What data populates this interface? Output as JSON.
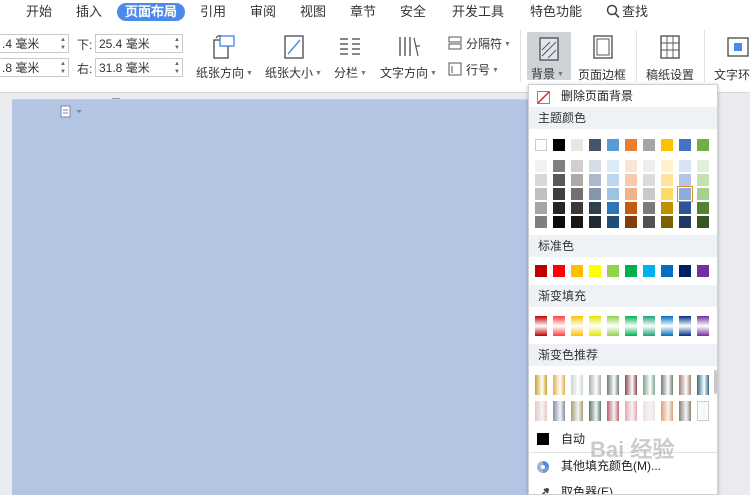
{
  "menu": {
    "tabs": [
      "开始",
      "插入",
      "页面布局",
      "引用",
      "审阅",
      "视图",
      "章节",
      "安全",
      "开发工具",
      "特色功能"
    ],
    "active": "页面布局",
    "search_label": "查找"
  },
  "ribbon": {
    "margin_top_value": ".4 毫米",
    "margin_left_value": ".8 毫米",
    "margin_bottom_label": "下:",
    "margin_bottom_value": "25.4 毫米",
    "margin_right_label": "右:",
    "margin_right_value": "31.8 毫米",
    "orientation": "纸张方向",
    "size": "纸张大小",
    "columns": "分栏",
    "text_direction": "文字方向",
    "separator": "分隔符",
    "line_number": "行号",
    "background": "背景",
    "page_border": "页面边框",
    "grid_paper": "稿纸设置",
    "wrap_text": "文字环"
  },
  "dropdown": {
    "remove_bg": "删除页面背景",
    "theme_colors_title": "主题颜色",
    "standard_colors_title": "标准色",
    "gradient_fill_title": "渐变填充",
    "gradient_recommend_title": "渐变色推荐",
    "auto_label": "自动",
    "more_fill": "其他填充颜色(M)...",
    "eyedropper": "取色器(E)",
    "theme_top": [
      "#ffffff",
      "#000000",
      "#e7e6e6",
      "#44546a",
      "#5b9bd5",
      "#ed7d31",
      "#a5a5a5",
      "#ffc000",
      "#4472c4",
      "#70ad47"
    ],
    "theme_grid": [
      [
        "#f2f2f2",
        "#7f7f7f",
        "#d0cece",
        "#d6dce4",
        "#deebf6",
        "#fbe5d5",
        "#ededed",
        "#fff2cc",
        "#dae3f3",
        "#e2efd9"
      ],
      [
        "#d8d8d8",
        "#595959",
        "#aeaaaa",
        "#adb9ca",
        "#bdd7ee",
        "#f7cbac",
        "#dbdbdb",
        "#fee599",
        "#b4c6e7",
        "#c5e0b3"
      ],
      [
        "#bfbfbf",
        "#3f3f3f",
        "#757070",
        "#8496b0",
        "#9cc3e5",
        "#f4b183",
        "#c9c9c9",
        "#ffd965",
        "#8eaadb",
        "#a8d08d"
      ],
      [
        "#a5a5a5",
        "#262626",
        "#3a3838",
        "#323f4f",
        "#2e75b5",
        "#c55a11",
        "#7b7b7b",
        "#bf9000",
        "#2f5496",
        "#538135"
      ],
      [
        "#7f7f7f",
        "#0c0c0c",
        "#171616",
        "#222a35",
        "#1e4e79",
        "#833c0b",
        "#525252",
        "#7f6000",
        "#1f3864",
        "#375623"
      ]
    ],
    "standard": [
      "#c00000",
      "#ff0000",
      "#ffc000",
      "#ffff00",
      "#92d050",
      "#00b050",
      "#00b0f0",
      "#0070c0",
      "#002060",
      "#7030a0"
    ],
    "gradients": [
      "#c00000",
      "#ff4040",
      "#ffc000",
      "#e6e600",
      "#92d050",
      "#00b050",
      "#1aa37a",
      "#0070c0",
      "#002f86",
      "#7030a0"
    ],
    "recommend_row1": [
      "#c9a227",
      "#e3b04b",
      "#c8d8d4",
      "#a6aeb0",
      "#6a7d7a",
      "#8b4a55",
      "#7fa58e",
      "#6f7f70",
      "#a08070",
      "#2e6e86"
    ],
    "recommend_row2": [
      "#e9c6c0",
      "#8090a8",
      "#a6a070",
      "#5a7a6a",
      "#c06070",
      "#eaa6b0",
      "#f0e0e0",
      "#e0a070",
      "#8a8070",
      "#ffffff"
    ]
  },
  "watermark": "Bai 经验"
}
